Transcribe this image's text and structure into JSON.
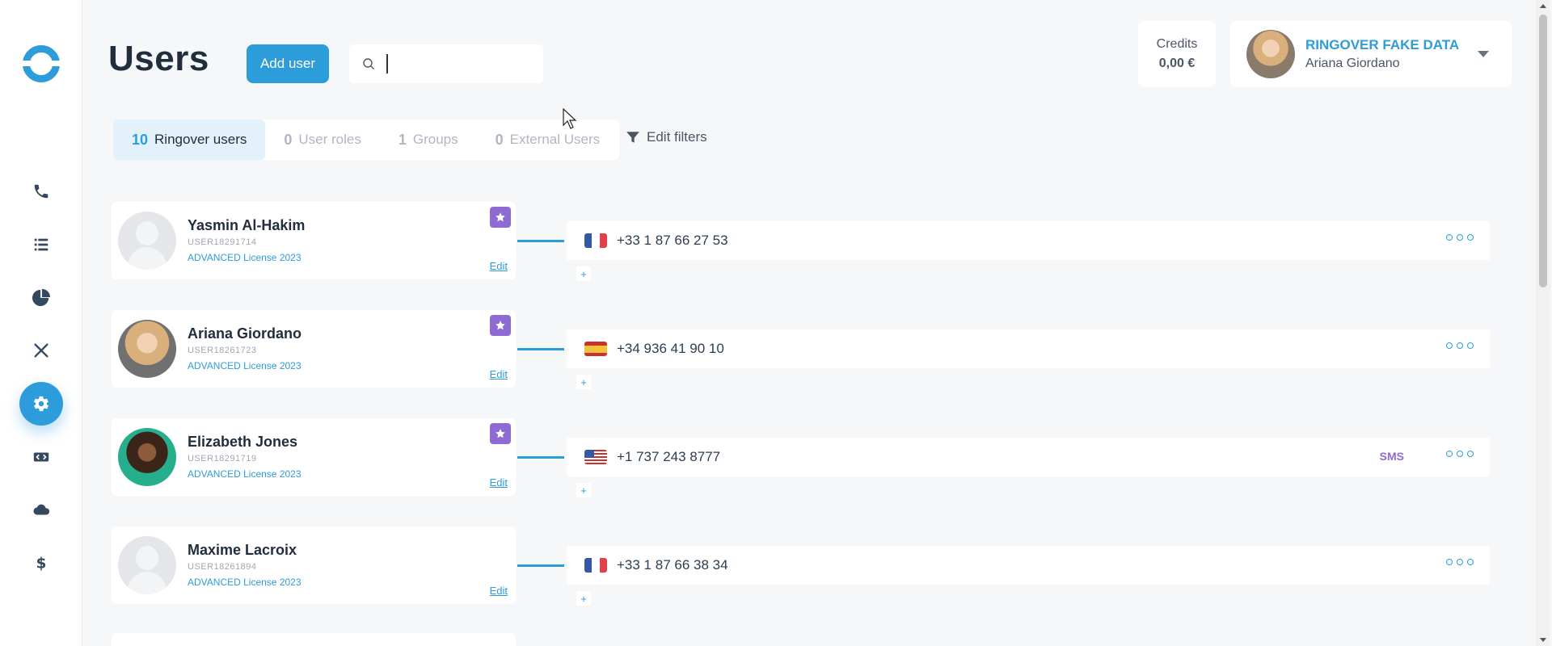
{
  "header": {
    "title": "Users",
    "add_user_label": "Add user",
    "search_placeholder": "",
    "credits_label": "Credits",
    "credits_value": "0,00 €",
    "account_company": "RINGOVER FAKE DATA",
    "account_user": "Ariana Giordano"
  },
  "sidebar": {
    "items": [
      {
        "name": "phone-icon"
      },
      {
        "name": "list-icon"
      },
      {
        "name": "pie-chart-icon"
      },
      {
        "name": "tools-icon"
      },
      {
        "name": "gear-icon",
        "active": true
      },
      {
        "name": "code-icon"
      },
      {
        "name": "cloud-icon"
      },
      {
        "name": "dollar-icon"
      }
    ]
  },
  "tabs": [
    {
      "count": "10",
      "label": "Ringover users",
      "active": true
    },
    {
      "count": "0",
      "label": "User roles"
    },
    {
      "count": "1",
      "label": "Groups"
    },
    {
      "count": "0",
      "label": "External Users"
    }
  ],
  "edit_filters_label": "Edit filters",
  "users": [
    {
      "name": "Yasmin Al-Hakim",
      "id": "USER18291714",
      "license": "ADVANCED License 2023",
      "edit": "Edit",
      "admin": true,
      "phone": "+33 1 87 66 27 53",
      "flag": "fr",
      "sms": ""
    },
    {
      "name": "Ariana Giordano",
      "id": "USER18261723",
      "license": "ADVANCED License 2023",
      "edit": "Edit",
      "admin": true,
      "phone": "+34 936 41 90 10",
      "flag": "es",
      "sms": ""
    },
    {
      "name": "Elizabeth Jones",
      "id": "USER18291719",
      "license": "ADVANCED License 2023",
      "edit": "Edit",
      "admin": true,
      "phone": "+1 737 243 8777",
      "flag": "us",
      "sms": "SMS"
    },
    {
      "name": "Maxime Lacroix",
      "id": "USER18261894",
      "license": "ADVANCED License 2023",
      "edit": "Edit",
      "admin": false,
      "phone": "+33 1 87 66 38 34",
      "flag": "fr",
      "sms": ""
    }
  ],
  "add_number_label": "+",
  "colors": {
    "accent": "#2d9cdb",
    "admin_badge": "#8e6bd3",
    "text": "#1f2d3d"
  }
}
